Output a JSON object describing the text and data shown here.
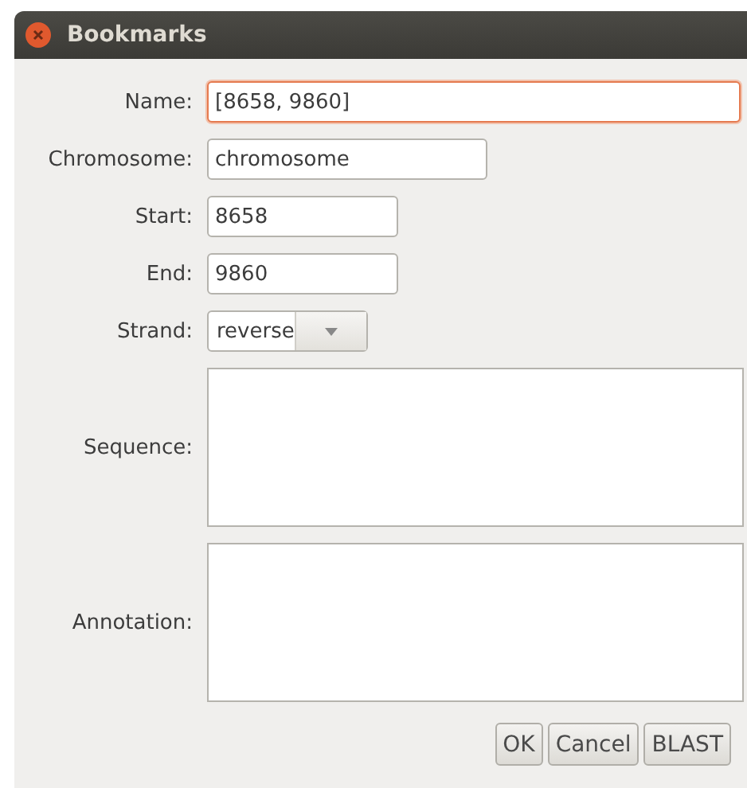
{
  "window": {
    "title": "Bookmarks"
  },
  "fields": [
    {
      "kind": "text",
      "label": "Name:",
      "value": "[8658, 9860]",
      "focused": true
    },
    {
      "kind": "text",
      "label": "Chromosome:",
      "value": "chromosome",
      "focused": false
    },
    {
      "kind": "text",
      "label": "Start:",
      "value": "8658",
      "focused": false
    },
    {
      "kind": "text",
      "label": "End:",
      "value": "9860",
      "focused": false
    },
    {
      "kind": "dropdown",
      "label": "Strand:",
      "value": "reverse"
    },
    {
      "kind": "textarea",
      "label": "Sequence:"
    },
    {
      "kind": "textarea",
      "label": "Annotation:"
    }
  ],
  "buttons": [
    "OK",
    "Cancel",
    "BLAST"
  ]
}
